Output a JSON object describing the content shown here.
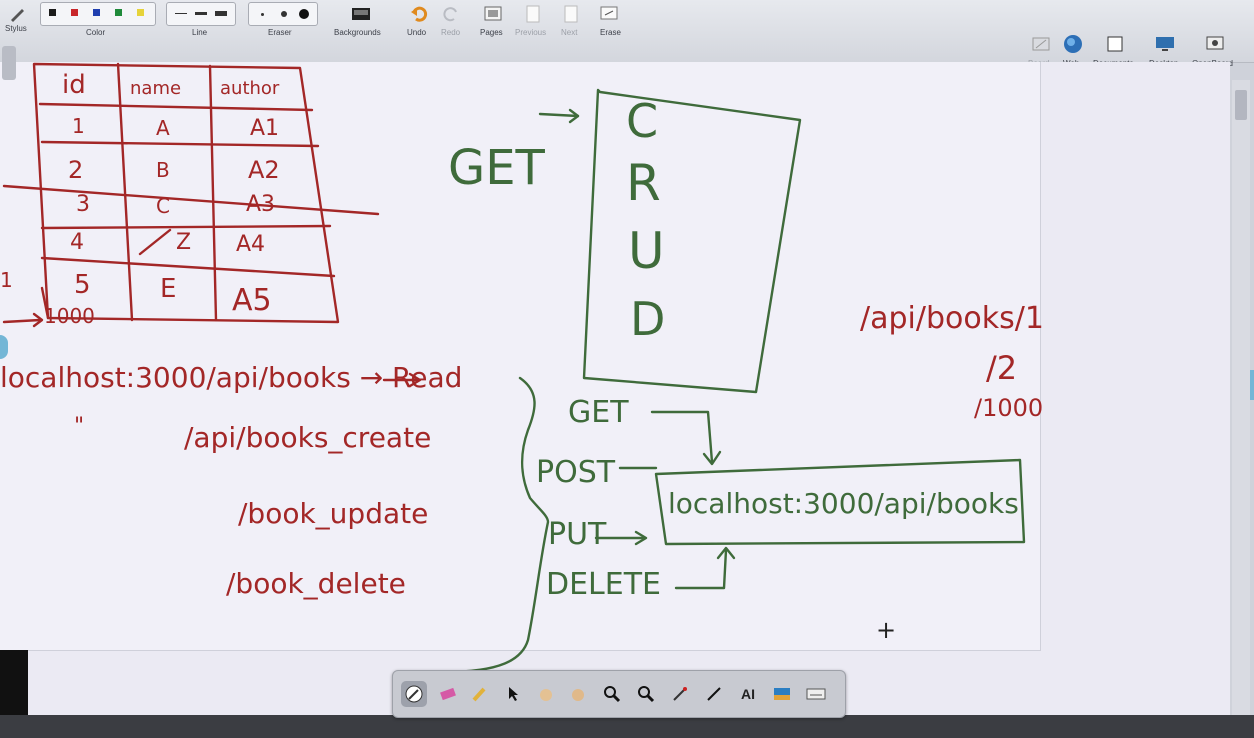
{
  "toolbar": {
    "stylus_label": "Stylus",
    "color_label": "Color",
    "line_label": "Line",
    "eraser_label": "Eraser",
    "backgrounds_label": "Backgrounds",
    "undo_label": "Undo",
    "redo_label": "Redo",
    "pages_label": "Pages",
    "previous_label": "Previous",
    "next_label": "Next",
    "erase_label": "Erase",
    "board_label": "Board",
    "web_label": "Web",
    "documents_label": "Documents",
    "desktop_label": "Desktop",
    "openboard_label": "OpenBoard",
    "colors": [
      "#1b1b1b",
      "#c8262a",
      "#1f3fb0",
      "#1f8a3a",
      "#e6d33a"
    ]
  },
  "board": {
    "table": {
      "headers": [
        "id",
        "name",
        "author"
      ],
      "rows": [
        [
          "1",
          "A",
          "A1"
        ],
        [
          "2",
          "B",
          "A2"
        ],
        [
          "3",
          "C",
          "A3"
        ],
        [
          "4",
          "Z",
          "A4"
        ],
        [
          "5",
          "E",
          "A5"
        ]
      ],
      "left_marker": "1",
      "overflow_count": "1000"
    },
    "get_label": "GET",
    "crud_letters": [
      "C",
      "R",
      "U",
      "D"
    ],
    "routes": {
      "read": "localhost:3000/api/books → Read",
      "ditto": "\"",
      "create": "/api/books_create",
      "update": "/book_update",
      "delete": "/book_delete"
    },
    "id_paths": {
      "first": "/api/books/1",
      "second": "/2",
      "third": "/1000"
    },
    "methods": [
      "GET",
      "POST",
      "PUT",
      "DELETE"
    ],
    "endpoint_box": "localhost:3000/api/books",
    "plus_mark": "+"
  },
  "palette": {
    "text_tool_label": "AI"
  }
}
